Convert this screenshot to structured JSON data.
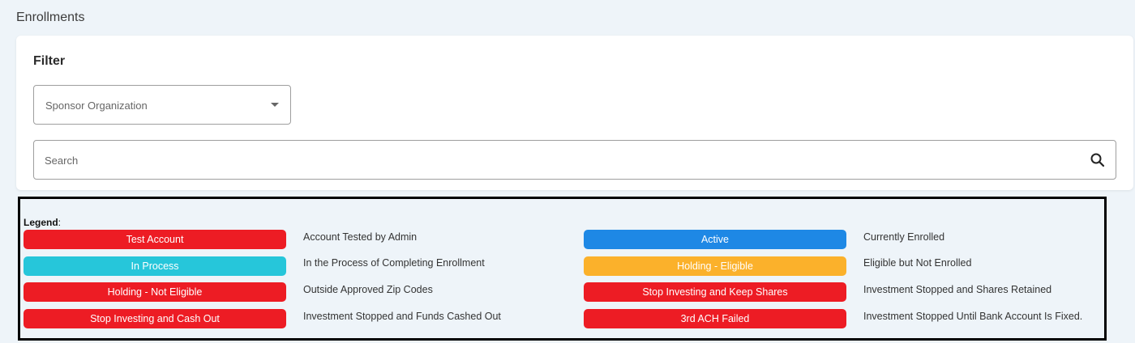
{
  "page": {
    "title": "Enrollments"
  },
  "filter": {
    "title": "Filter",
    "sponsor_select": {
      "placeholder": "Sponsor Organization"
    },
    "search": {
      "placeholder": "Search"
    }
  },
  "legend": {
    "label": "Legend",
    "items": [
      {
        "badge": "Test Account",
        "color": "#ed1c24",
        "desc": "Account Tested by Admin"
      },
      {
        "badge": "In Process",
        "color": "#26c6da",
        "desc": "In the Process of Completing Enrollment"
      },
      {
        "badge": "Holding - Not Eligible",
        "color": "#ed1c24",
        "desc": "Outside Approved Zip Codes"
      },
      {
        "badge": "Stop Investing and Cash Out",
        "color": "#ed1c24",
        "desc": "Investment Stopped and Funds Cashed Out"
      },
      {
        "badge": "Active",
        "color": "#1e88e5",
        "desc": "Currently Enrolled"
      },
      {
        "badge": "Holding - Eligible",
        "color": "#fbb12b",
        "desc": "Eligible but Not Enrolled"
      },
      {
        "badge": "Stop Investing and Keep Shares",
        "color": "#ed1c24",
        "desc": "Investment Stopped and Shares Retained"
      },
      {
        "badge": "3rd ACH Failed",
        "color": "#ed1c24",
        "desc": "Investment Stopped Until Bank Account Is Fixed."
      }
    ]
  }
}
